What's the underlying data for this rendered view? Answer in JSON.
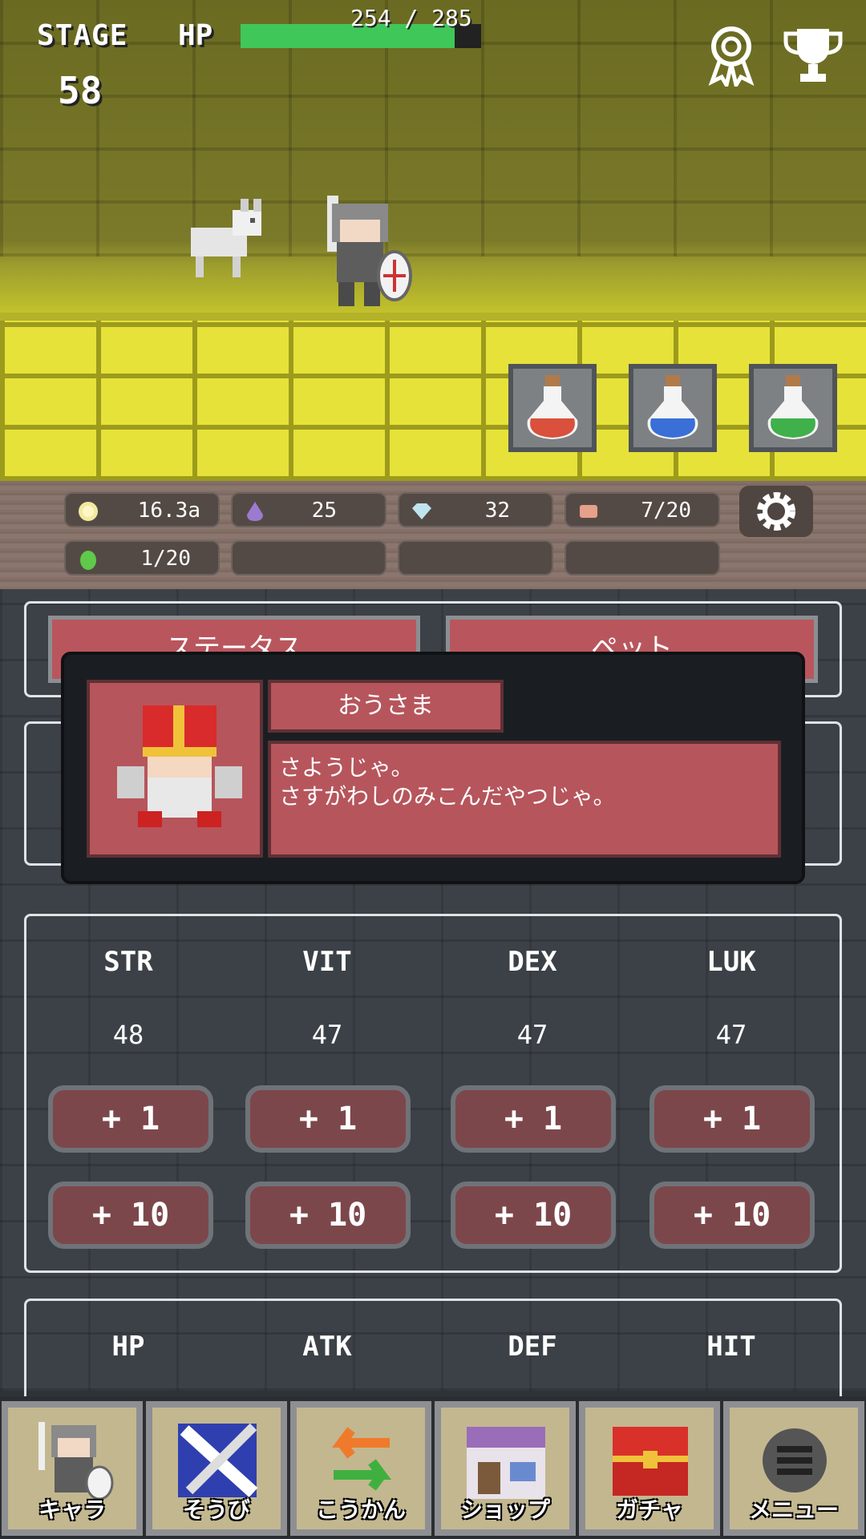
{
  "hud": {
    "stage_label": "STAGE",
    "stage_value": "58",
    "hp_label": "HP",
    "hp_text": "254 / 285",
    "hp_fraction": 0.891
  },
  "icons": {
    "achievements": "ribbon-medal-icon",
    "trophy": "trophy-icon",
    "potions": [
      "red-potion-icon",
      "blue-potion-icon",
      "green-potion-icon"
    ]
  },
  "currency": [
    {
      "icon": "coin-icon",
      "value": "16.3a",
      "color": "#f3e9a0"
    },
    {
      "icon": "purple-gem-icon",
      "value": "25",
      "color": "#9b7bd0"
    },
    {
      "icon": "diamond-icon",
      "value": "32",
      "color": "#bfe4f0"
    },
    {
      "icon": "scroll-icon",
      "value": "7/20",
      "color": "#e7a08a"
    },
    {
      "icon": "green-egg-icon",
      "value": "1/20",
      "color": "#5fc94a"
    }
  ],
  "tabs": [
    "ステータス",
    "ペット"
  ],
  "dialog": {
    "speaker": "おうさま",
    "message": "さようじゃ。\nさすがわしのみこんだやつじゃ。"
  },
  "stats": {
    "labels": [
      "STR",
      "VIT",
      "DEX",
      "LUK"
    ],
    "values": [
      "48",
      "47",
      "47",
      "47"
    ],
    "plus1": "+ 1",
    "plus10": "+ 10"
  },
  "substats": {
    "labels": [
      "HP",
      "ATK",
      "DEF",
      "HIT"
    ]
  },
  "nav": [
    {
      "label": "キャラ",
      "icon": "knight-icon"
    },
    {
      "label": "そうび",
      "icon": "sword-icon"
    },
    {
      "label": "こうかん",
      "icon": "exchange-icon"
    },
    {
      "label": "ショップ",
      "icon": "shop-icon"
    },
    {
      "label": "ガチャ",
      "icon": "gacha-chest-icon"
    },
    {
      "label": "メニュー",
      "icon": "menu-icon"
    }
  ],
  "colors": {
    "hp_fill": "#3fc75a",
    "button": "#b9565d",
    "dialog_box": "#b6555c"
  }
}
